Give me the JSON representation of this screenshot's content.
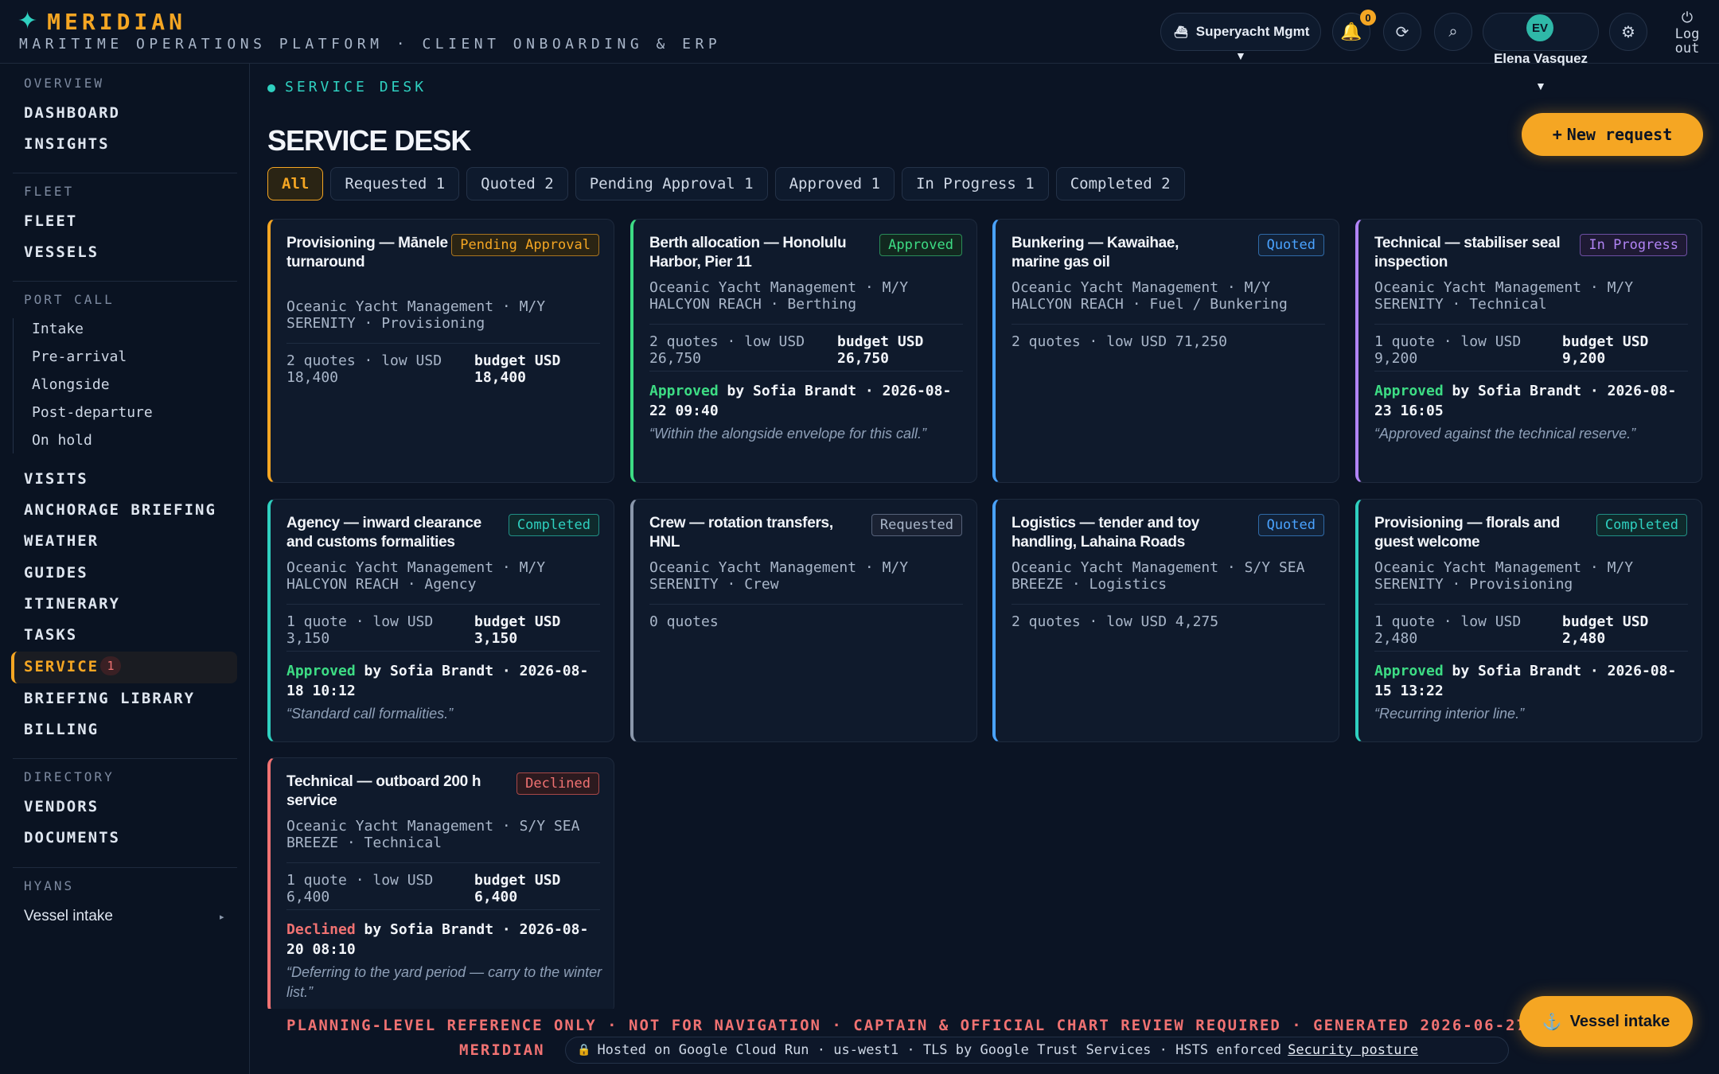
{
  "brand": {
    "name": "MERIDIAN",
    "subtitle": "MARITIME OPERATIONS PLATFORM · CLIENT ONBOARDING & ERP"
  },
  "header": {
    "workspace": "Superyacht Mgmt",
    "notifications_count": "0",
    "user": {
      "initials": "EV",
      "name": "Elena Vasquez"
    },
    "logout_label": "Log out"
  },
  "sidebar": {
    "overview": {
      "label": "OVERVIEW",
      "items": [
        "DASHBOARD",
        "INSIGHTS"
      ]
    },
    "fleet": {
      "label": "FLEET",
      "items": [
        "FLEET",
        "VESSELS"
      ]
    },
    "port_call": {
      "label": "PORT CALL",
      "items": [
        "Intake",
        "Pre-arrival",
        "Alongside",
        "Post-departure",
        "On hold"
      ]
    },
    "main_items": [
      "VISITS",
      "ANCHORAGE BRIEFING",
      "WEATHER",
      "GUIDES",
      "ITINERARY",
      "TASKS"
    ],
    "active": {
      "label": "SERVICE",
      "badge": "1"
    },
    "after_items": [
      "BRIEFING LIBRARY",
      "BILLING"
    ],
    "directory": {
      "label": "DIRECTORY",
      "items": [
        "VENDORS",
        "DOCUMENTS"
      ]
    },
    "hyans": {
      "label": "HYANS",
      "link": "Vessel intake"
    }
  },
  "main": {
    "breadcrumb": "SERVICE DESK",
    "title": "SERVICE DESK",
    "new_request": "New request",
    "filters": [
      "All",
      "Requested 1",
      "Quoted 2",
      "Pending Approval 1",
      "Approved 1",
      "In Progress 1",
      "Completed 2"
    ],
    "cards": [
      {
        "title": "Provisioning — Mānele Bay turnaround",
        "status": "Pending Approval",
        "meta": "Oceanic Yacht Management · M/Y SERENITY · Provisioning",
        "quotes": "2 quotes · low USD 18,400",
        "budget": "budget USD 18,400"
      },
      {
        "title": "Berth allocation — Honolulu Harbor, Pier 11",
        "status": "Approved",
        "meta": "Oceanic Yacht Management · M/Y HALCYON REACH · Berthing",
        "quotes": "2 quotes · low USD 26,750",
        "budget": "budget USD 26,750",
        "decision": "Approved",
        "decision_by": " by Sofia Brandt · 2026-08-22 09:40",
        "note": "“Within the alongside envelope for this call.”"
      },
      {
        "title": "Bunkering — Kawaihae, marine gas oil",
        "status": "Quoted",
        "meta": "Oceanic Yacht Management · M/Y HALCYON REACH · Fuel / Bunkering",
        "quotes": "2 quotes · low USD 71,250"
      },
      {
        "title": "Technical — stabiliser seal inspection",
        "status": "In Progress",
        "meta": "Oceanic Yacht Management · M/Y SERENITY · Technical",
        "quotes": "1 quote · low USD 9,200",
        "budget": "budget USD 9,200",
        "decision": "Approved",
        "decision_by": " by Sofia Brandt · 2026-08-23 16:05",
        "note": "“Approved against the technical reserve.”"
      },
      {
        "title": "Agency — inward clearance and customs formalities",
        "status": "Completed",
        "meta": "Oceanic Yacht Management · M/Y HALCYON REACH · Agency",
        "quotes": "1 quote · low USD 3,150",
        "budget": "budget USD 3,150",
        "decision": "Approved",
        "decision_by": " by Sofia Brandt · 2026-08-18 10:12",
        "note": "“Standard call formalities.”"
      },
      {
        "title": "Crew — rotation transfers, HNL",
        "status": "Requested",
        "meta": "Oceanic Yacht Management · M/Y SERENITY · Crew",
        "quotes": "0 quotes"
      },
      {
        "title": "Logistics — tender and toy handling, Lahaina Roads",
        "status": "Quoted",
        "meta": "Oceanic Yacht Management · S/Y SEA BREEZE · Logistics",
        "quotes": "2 quotes · low USD 4,275"
      },
      {
        "title": "Provisioning — florals and guest welcome",
        "status": "Completed",
        "meta": "Oceanic Yacht Management · M/Y SERENITY · Provisioning",
        "quotes": "1 quote · low USD 2,480",
        "budget": "budget USD 2,480",
        "decision": "Approved",
        "decision_by": " by Sofia Brandt · 2026-08-15 13:22",
        "note": "“Recurring interior line.”"
      },
      {
        "title": "Technical — outboard 200 h service",
        "status": "Declined",
        "meta": "Oceanic Yacht Management · S/Y SEA BREEZE · Technical",
        "quotes": "1 quote · low USD 6,400",
        "budget": "budget USD 6,400",
        "decision": "Declined",
        "decision_by": " by Sofia Brandt · 2026-08-20 08:10",
        "note": "“Deferring to the yard period — carry to the winter list.”"
      }
    ]
  },
  "footer": {
    "warning": "PLANNING-LEVEL REFERENCE ONLY · NOT FOR NAVIGATION · CAPTAIN & OFFICIAL CHART REVIEW REQUIRED  ·  GENERATED 2026-06-27",
    "brand": "MERIDIAN",
    "hosting": "Hosted on Google Cloud Run · us-west1  ·  TLS by Google Trust Services  ·  HSTS enforced",
    "security_link": "Security posture",
    "vessel_intake_btn": "Vessel intake"
  },
  "colors": {
    "accent": "#f5a623",
    "teal": "#2fd0c0",
    "background": "#0b1424",
    "status": {
      "Pending Approval": "#f5a623",
      "Approved": "#3ddc84",
      "Quoted": "#4aa3ff",
      "In Progress": "#b184f5",
      "Completed": "#2fd0c0",
      "Requested": "#8a97ab",
      "Declined": "#f07272"
    }
  }
}
